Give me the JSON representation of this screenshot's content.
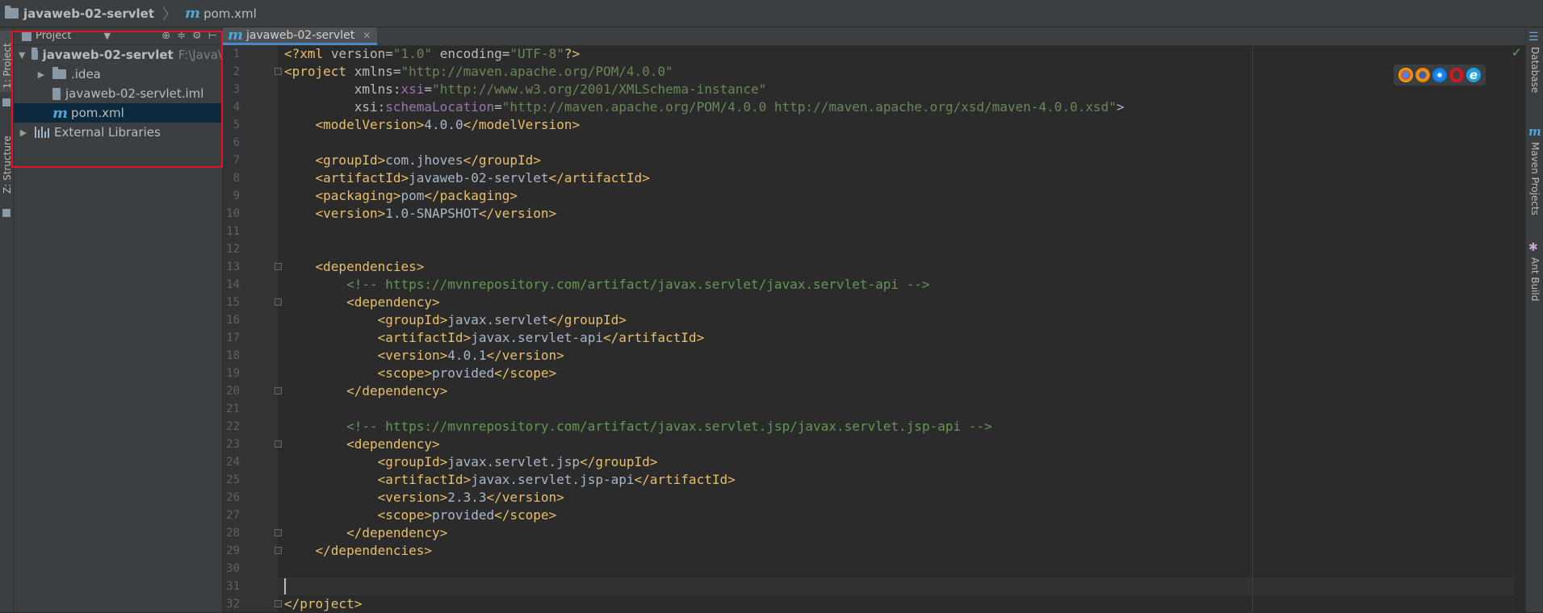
{
  "navbar": {
    "project": "javaweb-02-servlet",
    "file": "pom.xml"
  },
  "left_stripe": {
    "tab_project": "1: Project",
    "tab_structure": "Z: Structure"
  },
  "project_panel": {
    "header_title": "Project",
    "tree": [
      {
        "label": "javaweb-02-servlet",
        "hint": "F:\\Java\\",
        "type": "module-root"
      },
      {
        "label": ".idea",
        "type": "folder"
      },
      {
        "label": "javaweb-02-servlet.iml",
        "type": "iml-file"
      },
      {
        "label": "pom.xml",
        "type": "maven-file",
        "selected": true
      },
      {
        "label": "External Libraries",
        "type": "libraries"
      }
    ]
  },
  "editor": {
    "tab_label": "javaweb-02-servlet",
    "line_numbers": [
      "1",
      "2",
      "3",
      "4",
      "5",
      "6",
      "7",
      "8",
      "9",
      "10",
      "11",
      "12",
      "13",
      "14",
      "15",
      "16",
      "17",
      "18",
      "19",
      "20",
      "21",
      "22",
      "23",
      "24",
      "25",
      "26",
      "27",
      "28",
      "29",
      "30",
      "31",
      "32"
    ],
    "lines": [
      {
        "n": 1,
        "text": "<?xml version=\"1.0\" encoding=\"UTF-8\"?>"
      },
      {
        "n": 2,
        "text": "<project xmlns=\"http://maven.apache.org/POM/4.0.0\""
      },
      {
        "n": 3,
        "text": "         xmlns:xsi=\"http://www.w3.org/2001/XMLSchema-instance\""
      },
      {
        "n": 4,
        "text": "         xsi:schemaLocation=\"http://maven.apache.org/POM/4.0.0 http://maven.apache.org/xsd/maven-4.0.0.xsd\">"
      },
      {
        "n": 5,
        "text": "    <modelVersion>4.0.0</modelVersion>"
      },
      {
        "n": 6,
        "text": ""
      },
      {
        "n": 7,
        "text": "    <groupId>com.jhoves</groupId>"
      },
      {
        "n": 8,
        "text": "    <artifactId>javaweb-02-servlet</artifactId>"
      },
      {
        "n": 9,
        "text": "    <packaging>pom</packaging>"
      },
      {
        "n": 10,
        "text": "    <version>1.0-SNAPSHOT</version>"
      },
      {
        "n": 11,
        "text": ""
      },
      {
        "n": 12,
        "text": ""
      },
      {
        "n": 13,
        "text": "    <dependencies>"
      },
      {
        "n": 14,
        "text": "        <!-- https://mvnrepository.com/artifact/javax.servlet/javax.servlet-api -->"
      },
      {
        "n": 15,
        "text": "        <dependency>"
      },
      {
        "n": 16,
        "text": "            <groupId>javax.servlet</groupId>"
      },
      {
        "n": 17,
        "text": "            <artifactId>javax.servlet-api</artifactId>"
      },
      {
        "n": 18,
        "text": "            <version>4.0.1</version>"
      },
      {
        "n": 19,
        "text": "            <scope>provided</scope>"
      },
      {
        "n": 20,
        "text": "        </dependency>"
      },
      {
        "n": 21,
        "text": ""
      },
      {
        "n": 22,
        "text": "        <!-- https://mvnrepository.com/artifact/javax.servlet.jsp/javax.servlet.jsp-api -->"
      },
      {
        "n": 23,
        "text": "        <dependency>"
      },
      {
        "n": 24,
        "text": "            <groupId>javax.servlet.jsp</groupId>"
      },
      {
        "n": 25,
        "text": "            <artifactId>javax.servlet.jsp-api</artifactId>"
      },
      {
        "n": 26,
        "text": "            <version>2.3.3</version>"
      },
      {
        "n": 27,
        "text": "            <scope>provided</scope>"
      },
      {
        "n": 28,
        "text": "        </dependency>"
      },
      {
        "n": 29,
        "text": "    </dependencies>"
      },
      {
        "n": 30,
        "text": ""
      },
      {
        "n": 31,
        "text": ""
      },
      {
        "n": 32,
        "text": "</project>"
      }
    ],
    "current_line": 31
  },
  "browser_icons": [
    "chrome-icon",
    "firefox-icon",
    "safari-icon",
    "opera-icon",
    "ie-icon"
  ],
  "right_stripe": {
    "tab_database": "Database",
    "tab_maven": "Maven Projects",
    "tab_ant": "Ant Build"
  },
  "colors": {
    "background": "#2b2b2b",
    "tag": "#e8bf6a",
    "string": "#6a8759",
    "comment": "#629755",
    "namespace": "#9876aa",
    "selection": "#0d293e",
    "highlight_box": "#e81123"
  }
}
